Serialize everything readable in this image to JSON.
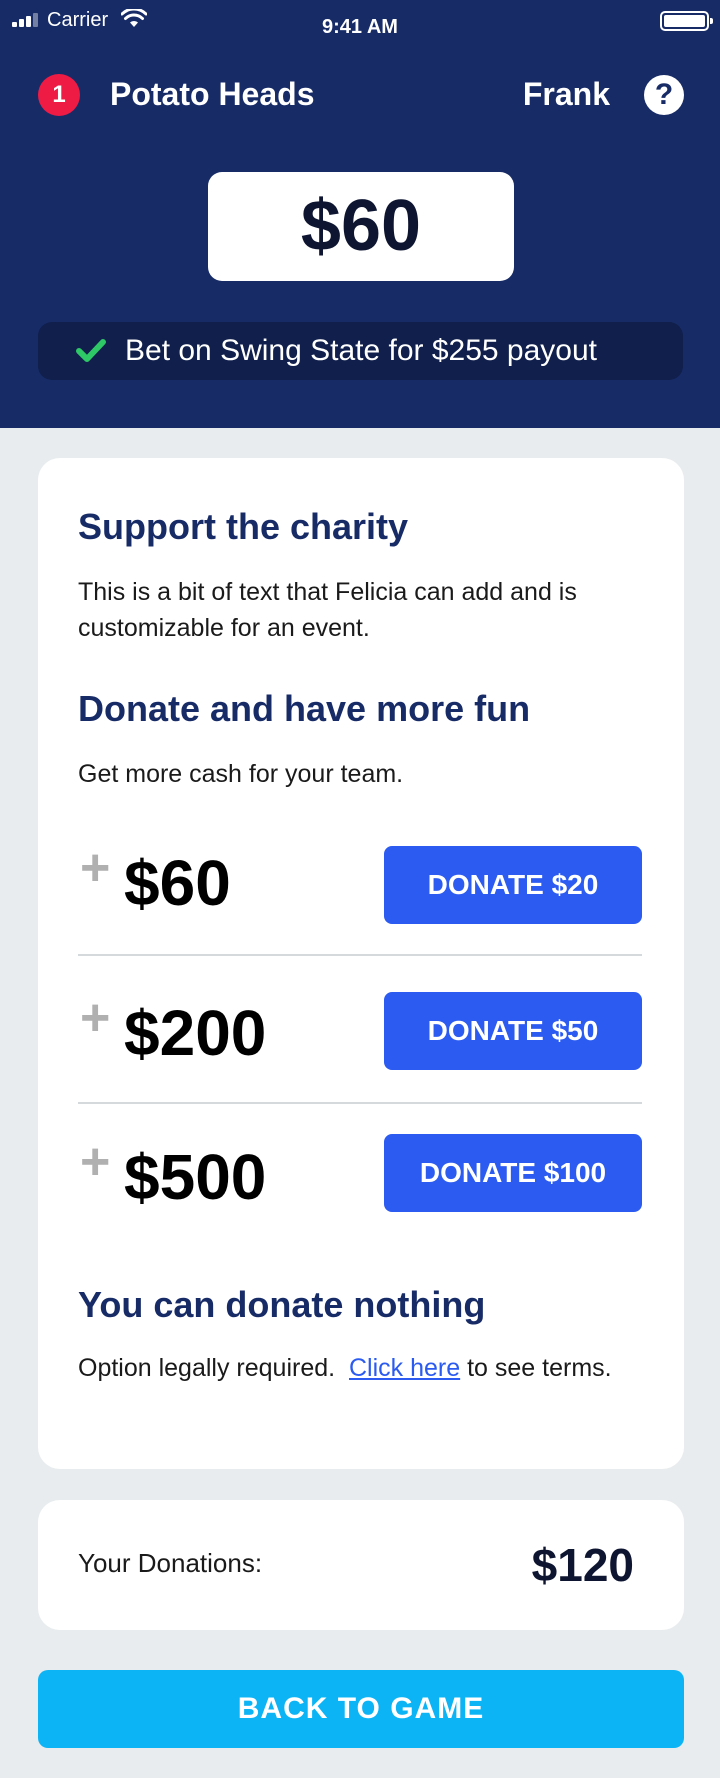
{
  "status_bar": {
    "carrier": "Carrier",
    "time": "9:41 AM"
  },
  "header": {
    "notification_count": "1",
    "team_name": "Potato Heads",
    "user_name": "Frank",
    "help_label": "?",
    "balance": "$60",
    "bet_message": "Bet on Swing State for $255 payout"
  },
  "charity": {
    "title": "Support the charity",
    "description": "This is a bit of text that Felicia can add and is customizable for an event.",
    "donate_title": "Donate and have more fun",
    "donate_subtitle": "Get more cash for your team.",
    "options": [
      {
        "plus": "+",
        "amount": "$60",
        "button_label": "DONATE $20"
      },
      {
        "plus": "+",
        "amount": "$200",
        "button_label": "DONATE $50"
      },
      {
        "plus": "+",
        "amount": "$500",
        "button_label": "DONATE $100"
      }
    ],
    "nothing_title": "You can donate nothing",
    "nothing_text_before": "Option legally required.",
    "nothing_link": "Click here",
    "nothing_text_after": "to see terms."
  },
  "donations": {
    "label": "Your Donations:",
    "value": "$120"
  },
  "back_button_label": "BACK TO GAME",
  "colors": {
    "header_bg": "#172b67",
    "badge": "#ee1c45",
    "check": "#2ec866",
    "donate_button": "#2b5bf0",
    "back_button": "#0db4f5",
    "page_bg": "#e8ecee"
  },
  "icons": [
    "signal-icon",
    "wifi-icon",
    "battery-icon",
    "help-icon",
    "check-icon",
    "plus-icon"
  ]
}
